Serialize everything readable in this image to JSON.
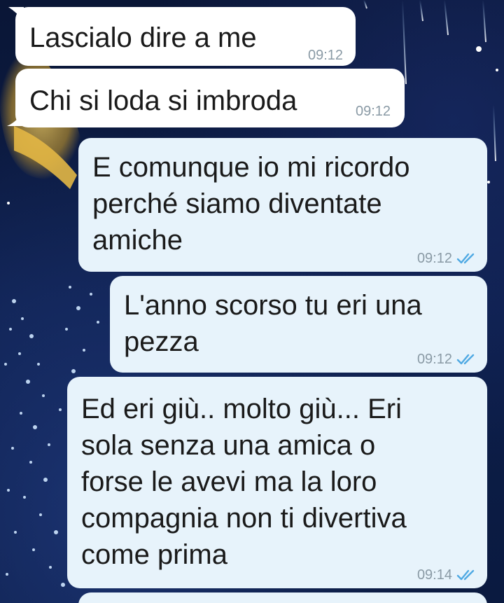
{
  "chat": {
    "messages": [
      {
        "direction": "incoming",
        "text": "Lascialo dire a me",
        "time": "09:12"
      },
      {
        "direction": "incoming",
        "text": "Chi si loda si imbroda",
        "time": "09:12"
      },
      {
        "direction": "outgoing",
        "text": "E comunque io mi ricordo\nperché siamo diventate\namiche",
        "time": "09:12",
        "status": "read"
      },
      {
        "direction": "outgoing",
        "text": "L'anno scorso tu eri una\npezza",
        "time": "09:12",
        "status": "read"
      },
      {
        "direction": "outgoing",
        "text": "Ed eri giù.. molto giù... Eri\nsola senza una amica o\nforse le avevi ma la loro\ncompagnia non ti divertiva\ncome prima",
        "time": "09:14",
        "status": "read"
      }
    ]
  },
  "colors": {
    "incoming_bubble": "#ffffff",
    "outgoing_bubble": "#e7f3fb",
    "read_tick": "#4fa9e3",
    "timestamp": "#8a9aa5",
    "wallpaper": "#0d1e4a"
  },
  "icons": {
    "read_receipt": "double-check-icon"
  }
}
